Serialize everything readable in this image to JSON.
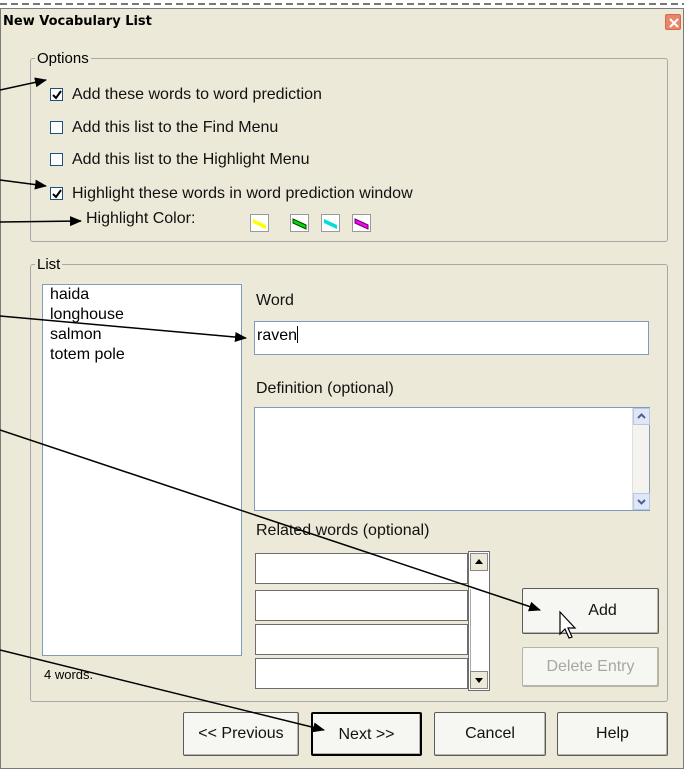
{
  "window": {
    "title": "New Vocabulary List"
  },
  "options": {
    "legend": "Options",
    "items": [
      {
        "label": "Add these words to word prediction",
        "checked": true
      },
      {
        "label": "Add this list to the Find Menu",
        "checked": false
      },
      {
        "label": "Add this list to the Highlight Menu",
        "checked": false
      },
      {
        "label": "Highlight these words in word prediction window",
        "checked": true
      }
    ],
    "highlight_label": "Highlight Color:",
    "colors": [
      "#ffff00",
      "#00dd00",
      "#00dddd",
      "#ff00ff"
    ]
  },
  "list": {
    "legend": "List",
    "words": [
      "haida",
      "longhouse",
      "salmon",
      "totem pole"
    ],
    "count": "4 words.",
    "word_label": "Word",
    "word_value": "raven",
    "definition_label": "Definition (optional)",
    "related_label": "Related words (optional)"
  },
  "buttons": {
    "add": "Add",
    "delete": "Delete Entry",
    "previous": "<< Previous",
    "next": "Next >>",
    "cancel": "Cancel",
    "help": "Help"
  }
}
